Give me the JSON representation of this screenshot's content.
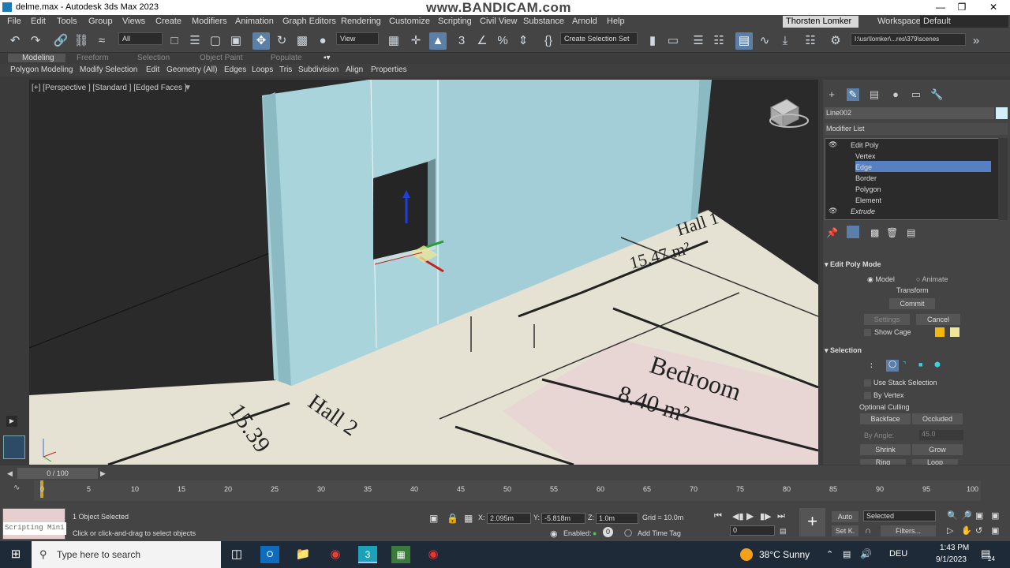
{
  "window": {
    "title": "delme.max - Autodesk 3ds Max 2023",
    "watermark": "www.BANDICAM.com"
  },
  "menu": [
    "File",
    "Edit",
    "Tools",
    "Group",
    "Views",
    "Create",
    "Modifiers",
    "Animation",
    "Graph Editors",
    "Rendering",
    "Customize",
    "Scripting",
    "Civil View",
    "Substance",
    "Arnold",
    "Help"
  ],
  "user": {
    "name": "Thorsten Lomker",
    "workspaces_label": "Workspaces:",
    "workspace": "Default"
  },
  "toolbar": {
    "filter": "All",
    "view": "View",
    "selection_set": "Create Selection Set",
    "path": "I:\\usr\\lomker\\...res\\379\\scenes"
  },
  "ribbon_tabs": [
    "Modeling",
    "Freeform",
    "Selection",
    "Object Paint",
    "Populate"
  ],
  "ribbon_items": [
    "Polygon Modeling",
    "Modify Selection",
    "Edit",
    "Geometry (All)",
    "Edges",
    "Loops",
    "Tris",
    "Subdivision",
    "Align",
    "Properties"
  ],
  "viewport": {
    "label": "[+] [Perspective ] [Standard ] [Edged Faces ]",
    "floor_text": {
      "hall1": "Hall 1",
      "hall1_area": "15.47 m²",
      "bedroom": "Bedroom",
      "bedroom_area": "8.40 m²",
      "hall2": "Hall 2",
      "hall2_area": "15.39"
    }
  },
  "command_panel": {
    "object_name": "Line002",
    "object_color": "#d2f0f5",
    "modifier_list": "Modifier List",
    "stack": [
      "Edit Poly",
      "Vertex",
      "Edge",
      "Border",
      "Polygon",
      "Element",
      "Extrude"
    ],
    "selected": "Edge",
    "edit_poly_mode": {
      "title": "Edit Poly Mode",
      "model": "Model",
      "animate": "Animate",
      "transform": "Transform",
      "commit": "Commit",
      "settings": "Settings",
      "cancel": "Cancel",
      "show_cage": "Show Cage"
    },
    "selection": {
      "title": "Selection",
      "use_stack": "Use Stack Selection",
      "by_vertex": "By Vertex",
      "optional_culling": "Optional Culling",
      "backface": "Backface",
      "occluded": "Occluded",
      "by_angle": "By Angle:",
      "angle": "45.0",
      "shrink": "Shrink",
      "grow": "Grow",
      "ring": "Ring",
      "loop": "Loop"
    }
  },
  "timeline": {
    "frame": "0 / 100",
    "ticks": [
      "0",
      "5",
      "10",
      "15",
      "20",
      "25",
      "30",
      "35",
      "40",
      "45",
      "50",
      "55",
      "60",
      "65",
      "70",
      "75",
      "80",
      "85",
      "90",
      "95",
      "100"
    ]
  },
  "status": {
    "script": "Scripting Mini",
    "selected": "1 Object Selected",
    "hint": "Click or click-and-drag to select objects",
    "x_label": "X:",
    "x": "2.095m",
    "y_label": "Y:",
    "y": "-5.818m",
    "z_label": "Z:",
    "z": "1.0m",
    "grid": "Grid = 10.0m",
    "enabled": "Enabled:",
    "add_time_tag": "Add Time Tag",
    "auto": "Auto",
    "setk": "Set K.",
    "key_mode": "Selected",
    "filters": "Filters...",
    "frame_field": "0"
  },
  "taskbar": {
    "search": "Type here to search",
    "weather": "38°C  Sunny",
    "lang": "DEU",
    "time": "1:43 PM",
    "date": "9/1/2023",
    "notif": "24"
  }
}
